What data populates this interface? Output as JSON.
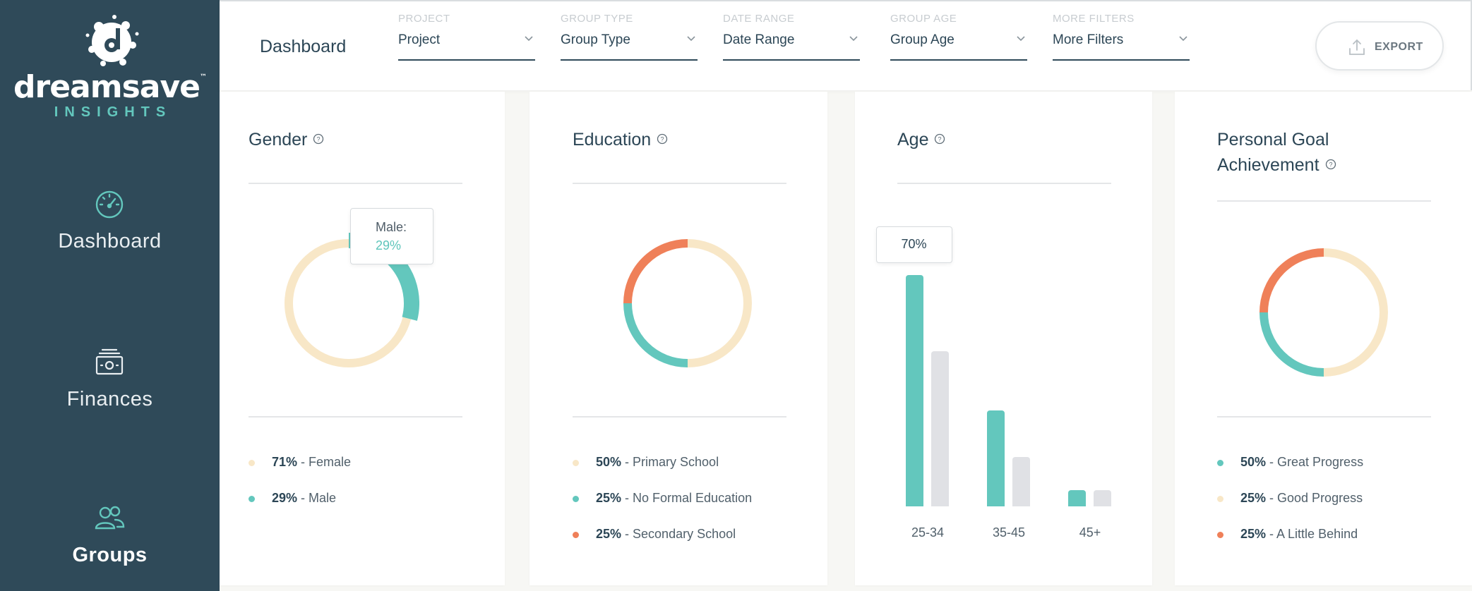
{
  "app": {
    "brand_word": "dreamsave",
    "brand_tm": "™",
    "brand_sub": "INSIGHTS"
  },
  "colors": {
    "teal": "#63c7bd",
    "cream": "#f8e7c7",
    "coral": "#ef8059",
    "grey_bar": "#e0e1e5",
    "sidebar": "#2f4a59"
  },
  "sidebar": {
    "items": [
      {
        "label": "Dashboard",
        "icon": "speedometer-icon"
      },
      {
        "label": "Finances",
        "icon": "cash-stack-icon"
      },
      {
        "label": "Groups",
        "icon": "users-icon",
        "active": true
      }
    ]
  },
  "header": {
    "title": "Dashboard",
    "filters": [
      {
        "caption": "PROJECT",
        "value": "Project"
      },
      {
        "caption": "GROUP TYPE",
        "value": "Group Type"
      },
      {
        "caption": "DATE RANGE",
        "value": "Date Range"
      },
      {
        "caption": "GROUP AGE",
        "value": "Group Age"
      },
      {
        "caption": "MORE FILTERS",
        "value": "More Filters"
      }
    ],
    "export_label": "EXPORT"
  },
  "cards": {
    "gender": {
      "title": "Gender",
      "tooltip": {
        "label": "Male:",
        "value": "29%"
      },
      "legend": [
        {
          "pct": "71%",
          "text": " - Female",
          "color": "#f8e7c7"
        },
        {
          "pct": "29%",
          "text": " - Male",
          "color": "#63c7bd"
        }
      ]
    },
    "education": {
      "title": "Education",
      "legend": [
        {
          "pct": "50%",
          "text": " - Primary School",
          "color": "#f8e7c7"
        },
        {
          "pct": "25%",
          "text": " - No Formal Education",
          "color": "#63c7bd"
        },
        {
          "pct": "25%",
          "text": " - Secondary School",
          "color": "#ef8059"
        }
      ]
    },
    "age": {
      "title": "Age",
      "tooltip": "70%"
    },
    "goal": {
      "title_line1": "Personal Goal",
      "title_line2": "Achievement",
      "legend": [
        {
          "pct": "50%",
          "text": " - Great Progress",
          "color": "#63c7bd"
        },
        {
          "pct": "25%",
          "text": " - Good Progress",
          "color": "#f8e7c7"
        },
        {
          "pct": "25%",
          "text": " - A Little Behind",
          "color": "#ef8059"
        }
      ]
    }
  },
  "chart_data": [
    {
      "type": "pie",
      "title": "Gender",
      "categories": [
        "Female",
        "Male"
      ],
      "values": [
        71,
        29
      ],
      "colors": [
        "#f8e7c7",
        "#63c7bd"
      ],
      "highlighted": "Male"
    },
    {
      "type": "pie",
      "title": "Education",
      "categories": [
        "Primary School",
        "No Formal Education",
        "Secondary School"
      ],
      "values": [
        50,
        25,
        25
      ],
      "colors": [
        "#f8e7c7",
        "#63c7bd",
        "#ef8059"
      ]
    },
    {
      "type": "bar",
      "title": "Age",
      "categories": [
        "25-34",
        "35-45",
        "45+"
      ],
      "series": [
        {
          "values": [
            70,
            29,
            5
          ],
          "color": "#63c7bd"
        },
        {
          "values": [
            47,
            15,
            5
          ],
          "color": "#e0e1e5"
        }
      ],
      "ylim": [
        0,
        70
      ],
      "tooltip_value": "70%"
    },
    {
      "type": "pie",
      "title": "Personal Goal Achievement",
      "categories": [
        "Great Progress",
        "Good Progress",
        "A Little Behind"
      ],
      "values": [
        50,
        25,
        25
      ],
      "colors": [
        "#63c7bd",
        "#f8e7c7",
        "#ef8059"
      ]
    }
  ]
}
